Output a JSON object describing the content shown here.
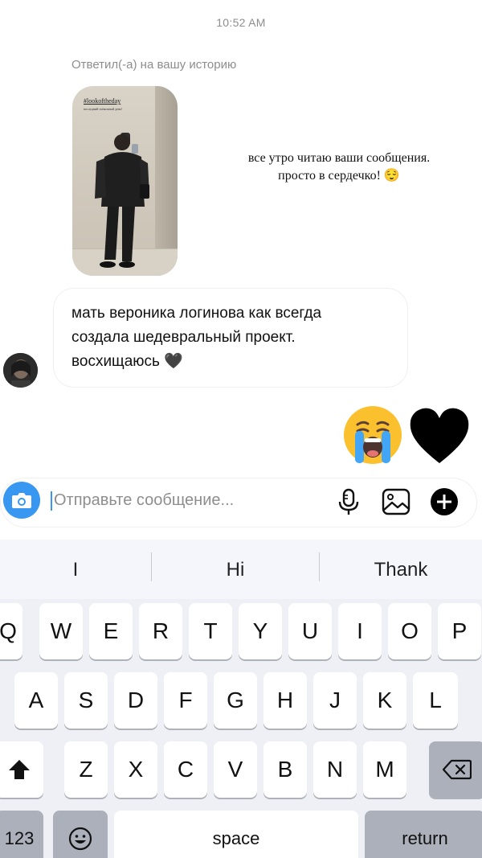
{
  "thread": {
    "timestamp": "10:52 AM",
    "replied_label": "Ответил(-а) на вашу историю",
    "story": {
      "tag": "#lookoftheday",
      "subtitle": "последний съёмочный день!",
      "caption_lines": [
        "все утро читаю ваши сообщения.",
        "просто в сердечко! 😌"
      ]
    },
    "incoming_message": {
      "lines": [
        "мать вероника логинова как всегда",
        "создала шедевральный проект.",
        "восхищаюсь 🖤"
      ]
    },
    "outgoing_emojis": [
      "crying-face",
      "black-heart"
    ]
  },
  "composer": {
    "placeholder": "Отправьте сообщение...",
    "value": ""
  },
  "keyboard": {
    "suggestions": [
      "I",
      "Hi",
      "Thank"
    ],
    "row1": [
      "Q",
      "W",
      "E",
      "R",
      "T",
      "Y",
      "U",
      "I",
      "O",
      "P"
    ],
    "row2": [
      "A",
      "S",
      "D",
      "F",
      "G",
      "H",
      "J",
      "K",
      "L"
    ],
    "row3": [
      "Z",
      "X",
      "C",
      "V",
      "B",
      "N",
      "M"
    ],
    "numbers_label": "123",
    "space_label": "space",
    "return_label": "return"
  },
  "colors": {
    "accent": "#3897f0",
    "meta_text": "#8e8e8e",
    "emoji_yellow": "#fbc02d",
    "keyboard_bg": "#eef0f5"
  }
}
